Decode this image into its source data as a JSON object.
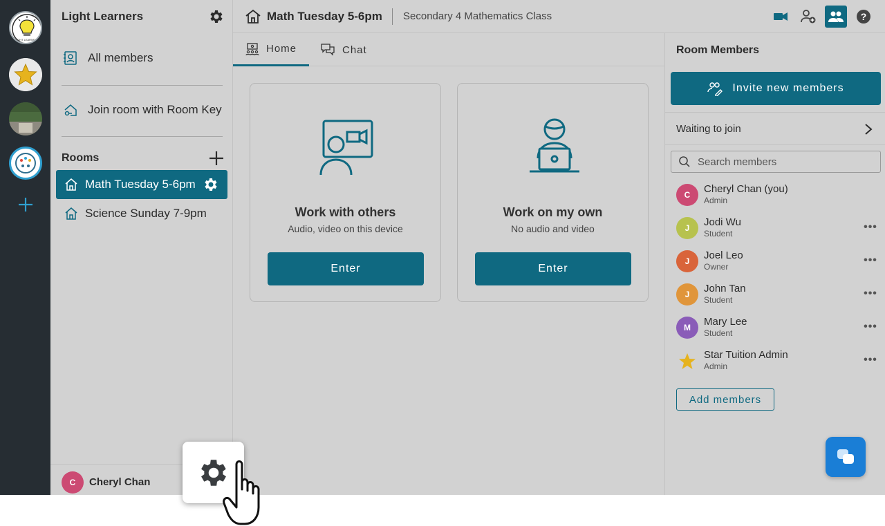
{
  "org": {
    "name": "Light Learners",
    "logo_icon": "lightbulb-logo",
    "logo_text": "LIGHT LEARNERS"
  },
  "rail": {
    "orgs": [
      {
        "name": "light-learners",
        "icon": "lightbulb-logo"
      },
      {
        "name": "star-tuition",
        "icon": "star-icon"
      },
      {
        "name": "photo-org",
        "icon": "photo-thumbnail"
      },
      {
        "name": "dots-org",
        "icon": "dotted-face-icon"
      }
    ],
    "add_icon": "plus-icon"
  },
  "sidebar": {
    "all_members": "All members",
    "join_room": "Join room with Room Key",
    "rooms_label": "Rooms",
    "rooms": [
      {
        "label": "Math Tuesday 5-6pm",
        "active": true
      },
      {
        "label": "Science Sunday 7-9pm",
        "active": false
      }
    ],
    "current_user": {
      "initial": "C",
      "name": "Cheryl Chan"
    }
  },
  "header": {
    "room_title": "Math Tuesday 5-6pm",
    "room_subtitle": "Secondary 4 Mathematics Class",
    "buttons": [
      "video-icon",
      "add-person-icon",
      "members-icon",
      "help-icon"
    ]
  },
  "tabs": [
    {
      "label": "Home",
      "active": true
    },
    {
      "label": "Chat",
      "active": false
    }
  ],
  "modes": [
    {
      "title": "Work with others",
      "subtitle": "Audio, video on this device",
      "button": "Enter"
    },
    {
      "title": "Work on my own",
      "subtitle": "No audio and video",
      "button": "Enter"
    }
  ],
  "members_panel": {
    "title": "Room Members",
    "invite_label": "Invite new members",
    "waiting_label": "Waiting to join",
    "search_placeholder": "Search members",
    "add_members_label": "Add members",
    "members": [
      {
        "initial": "C",
        "name": "Cheryl Chan (you)",
        "role": "Admin",
        "color": "#cc4a73",
        "more": false
      },
      {
        "initial": "J",
        "name": "Jodi Wu",
        "role": "Student",
        "color": "#b7c24e",
        "more": true
      },
      {
        "initial": "J",
        "name": "Joel Leo",
        "role": "Owner",
        "color": "#d9643a",
        "more": true
      },
      {
        "initial": "J",
        "name": "John Tan",
        "role": "Student",
        "color": "#e0953a",
        "more": true
      },
      {
        "initial": "M",
        "name": "Mary Lee",
        "role": "Student",
        "color": "#8a5cb8",
        "more": true
      },
      {
        "initial": "",
        "name": "Star Tuition Admin",
        "role": "Admin",
        "color": "#e6b31e",
        "more": true
      }
    ]
  },
  "colors": {
    "accent": "#0f6981",
    "background": "#d2d2d2",
    "rail": "#262d33",
    "fab": "#1a7ed6"
  }
}
